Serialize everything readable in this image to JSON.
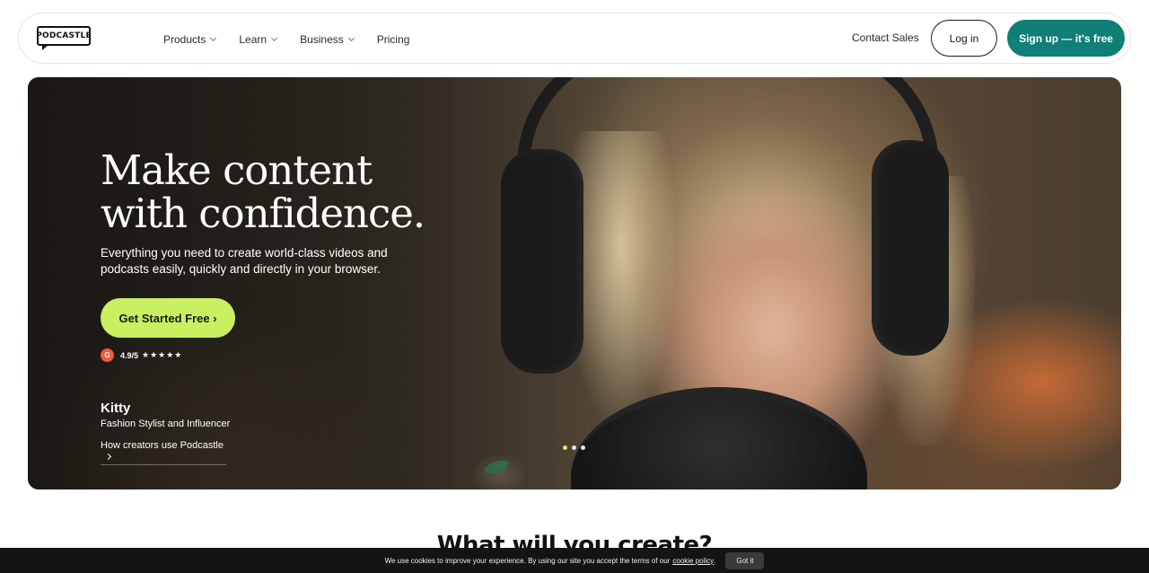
{
  "nav": {
    "logo_text": "PODCASTLE",
    "menu": [
      {
        "label": "Products",
        "has_dropdown": true
      },
      {
        "label": "Learn",
        "has_dropdown": true
      },
      {
        "label": "Business",
        "has_dropdown": true
      },
      {
        "label": "Pricing",
        "has_dropdown": false
      }
    ],
    "contact_label": "Contact Sales",
    "login_label": "Log in",
    "signup_label": "Sign up — it's free",
    "signup_color": "#0f7f77"
  },
  "hero": {
    "title_line1": "Make content",
    "title_line2": "with confidence.",
    "subtitle": "Everything you need to create world-class videos and podcasts easily, quickly and directly in your browser.",
    "cta_label": "Get Started Free ›",
    "cta_color": "#c8f060",
    "rating": {
      "badge": "G",
      "score": "4.9/5",
      "stars": "★★★★★"
    },
    "creator": {
      "name": "Kitty",
      "role": "Fashion Stylist and Influencer",
      "link_label": "How creators use Podcastle"
    },
    "carousel": {
      "total": 3,
      "active_index": 0
    }
  },
  "section": {
    "title": "What will you create?"
  },
  "cookie": {
    "text": "We use cookies to improve your experience. By using our site you accept the terms of our",
    "link_label": "cookie policy",
    "button_label": "Got it"
  }
}
